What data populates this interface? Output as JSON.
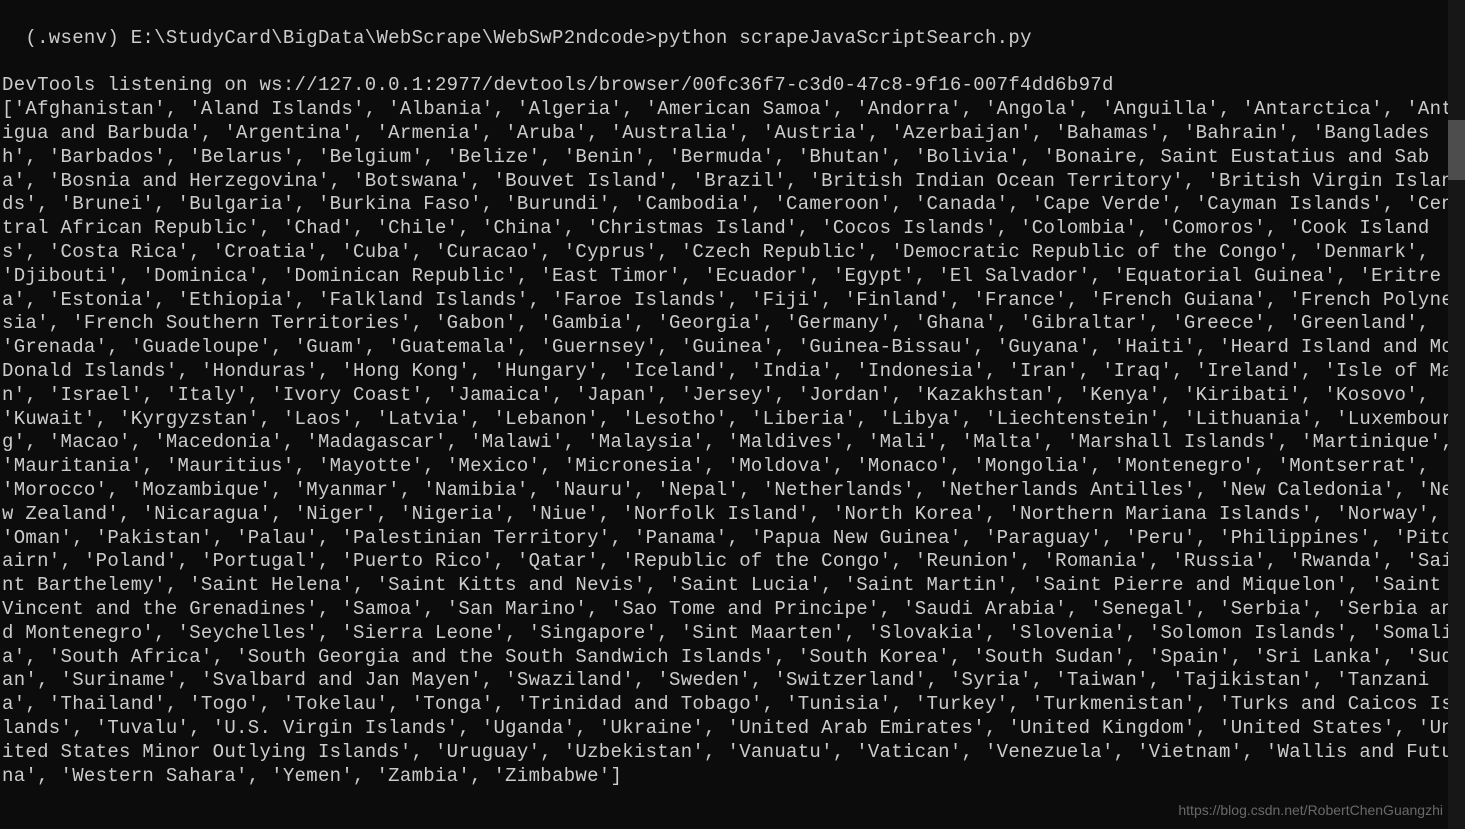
{
  "prompt": {
    "env": "(.wsenv)",
    "path": "E:\\StudyCard\\BigData\\WebScrape\\WebSwP2ndcode>",
    "command": "python scrapeJavaScriptSearch.py"
  },
  "devtools_line": "DevTools listening on ws://127.0.0.1:2977/devtools/browser/00fc36f7-c3d0-47c8-9f16-007f4dd6b97d",
  "countries": [
    "Afghanistan",
    "Aland Islands",
    "Albania",
    "Algeria",
    "American Samoa",
    "Andorra",
    "Angola",
    "Anguilla",
    "Antarctica",
    "Antigua and Barbuda",
    "Argentina",
    "Armenia",
    "Aruba",
    "Australia",
    "Austria",
    "Azerbaijan",
    "Bahamas",
    "Bahrain",
    "Bangladesh",
    "Barbados",
    "Belarus",
    "Belgium",
    "Belize",
    "Benin",
    "Bermuda",
    "Bhutan",
    "Bolivia",
    "Bonaire, Saint Eustatius and Saba",
    "Bosnia and Herzegovina",
    "Botswana",
    "Bouvet Island",
    "Brazil",
    "British Indian Ocean Territory",
    "British Virgin Islands",
    "Brunei",
    "Bulgaria",
    "Burkina Faso",
    "Burundi",
    "Cambodia",
    "Cameroon",
    "Canada",
    "Cape Verde",
    "Cayman Islands",
    "Central African Republic",
    "Chad",
    "Chile",
    "China",
    "Christmas Island",
    "Cocos Islands",
    "Colombia",
    "Comoros",
    "Cook Islands",
    "Costa Rica",
    "Croatia",
    "Cuba",
    "Curacao",
    "Cyprus",
    "Czech Republic",
    "Democratic Republic of the Congo",
    "Denmark",
    "Djibouti",
    "Dominica",
    "Dominican Republic",
    "East Timor",
    "Ecuador",
    "Egypt",
    "El Salvador",
    "Equatorial Guinea",
    "Eritrea",
    "Estonia",
    "Ethiopia",
    "Falkland Islands",
    "Faroe Islands",
    "Fiji",
    "Finland",
    "France",
    "French Guiana",
    "French Polynesia",
    "French Southern Territories",
    "Gabon",
    "Gambia",
    "Georgia",
    "Germany",
    "Ghana",
    "Gibraltar",
    "Greece",
    "Greenland",
    "Grenada",
    "Guadeloupe",
    "Guam",
    "Guatemala",
    "Guernsey",
    "Guinea",
    "Guinea-Bissau",
    "Guyana",
    "Haiti",
    "Heard Island and McDonald Islands",
    "Honduras",
    "Hong Kong",
    "Hungary",
    "Iceland",
    "India",
    "Indonesia",
    "Iran",
    "Iraq",
    "Ireland",
    "Isle of Man",
    "Israel",
    "Italy",
    "Ivory Coast",
    "Jamaica",
    "Japan",
    "Jersey",
    "Jordan",
    "Kazakhstan",
    "Kenya",
    "Kiribati",
    "Kosovo",
    "Kuwait",
    "Kyrgyzstan",
    "Laos",
    "Latvia",
    "Lebanon",
    "Lesotho",
    "Liberia",
    "Libya",
    "Liechtenstein",
    "Lithuania",
    "Luxembourg",
    "Macao",
    "Macedonia",
    "Madagascar",
    "Malawi",
    "Malaysia",
    "Maldives",
    "Mali",
    "Malta",
    "Marshall Islands",
    "Martinique",
    "Mauritania",
    "Mauritius",
    "Mayotte",
    "Mexico",
    "Micronesia",
    "Moldova",
    "Monaco",
    "Mongolia",
    "Montenegro",
    "Montserrat",
    "Morocco",
    "Mozambique",
    "Myanmar",
    "Namibia",
    "Nauru",
    "Nepal",
    "Netherlands",
    "Netherlands Antilles",
    "New Caledonia",
    "New Zealand",
    "Nicaragua",
    "Niger",
    "Nigeria",
    "Niue",
    "Norfolk Island",
    "North Korea",
    "Northern Mariana Islands",
    "Norway",
    "Oman",
    "Pakistan",
    "Palau",
    "Palestinian Territory",
    "Panama",
    "Papua New Guinea",
    "Paraguay",
    "Peru",
    "Philippines",
    "Pitcairn",
    "Poland",
    "Portugal",
    "Puerto Rico",
    "Qatar",
    "Republic of the Congo",
    "Reunion",
    "Romania",
    "Russia",
    "Rwanda",
    "Saint Barthelemy",
    "Saint Helena",
    "Saint Kitts and Nevis",
    "Saint Lucia",
    "Saint Martin",
    "Saint Pierre and Miquelon",
    "Saint Vincent and the Grenadines",
    "Samoa",
    "San Marino",
    "Sao Tome and Principe",
    "Saudi Arabia",
    "Senegal",
    "Serbia",
    "Serbia and Montenegro",
    "Seychelles",
    "Sierra Leone",
    "Singapore",
    "Sint Maarten",
    "Slovakia",
    "Slovenia",
    "Solomon Islands",
    "Somalia",
    "South Africa",
    "South Georgia and the South Sandwich Islands",
    "South Korea",
    "South Sudan",
    "Spain",
    "Sri Lanka",
    "Sudan",
    "Suriname",
    "Svalbard and Jan Mayen",
    "Swaziland",
    "Sweden",
    "Switzerland",
    "Syria",
    "Taiwan",
    "Tajikistan",
    "Tanzania",
    "Thailand",
    "Togo",
    "Tokelau",
    "Tonga",
    "Trinidad and Tobago",
    "Tunisia",
    "Turkey",
    "Turkmenistan",
    "Turks and Caicos Islands",
    "Tuvalu",
    "U.S. Virgin Islands",
    "Uganda",
    "Ukraine",
    "United Arab Emirates",
    "United Kingdom",
    "United States",
    "United States Minor Outlying Islands",
    "Uruguay",
    "Uzbekistan",
    "Vanuatu",
    "Vatican",
    "Venezuela",
    "Vietnam",
    "Wallis and Futuna",
    "Western Sahara",
    "Yemen",
    "Zambia",
    "Zimbabwe"
  ],
  "watermark": "https://blog.csdn.net/RobertChenGuangzhi"
}
